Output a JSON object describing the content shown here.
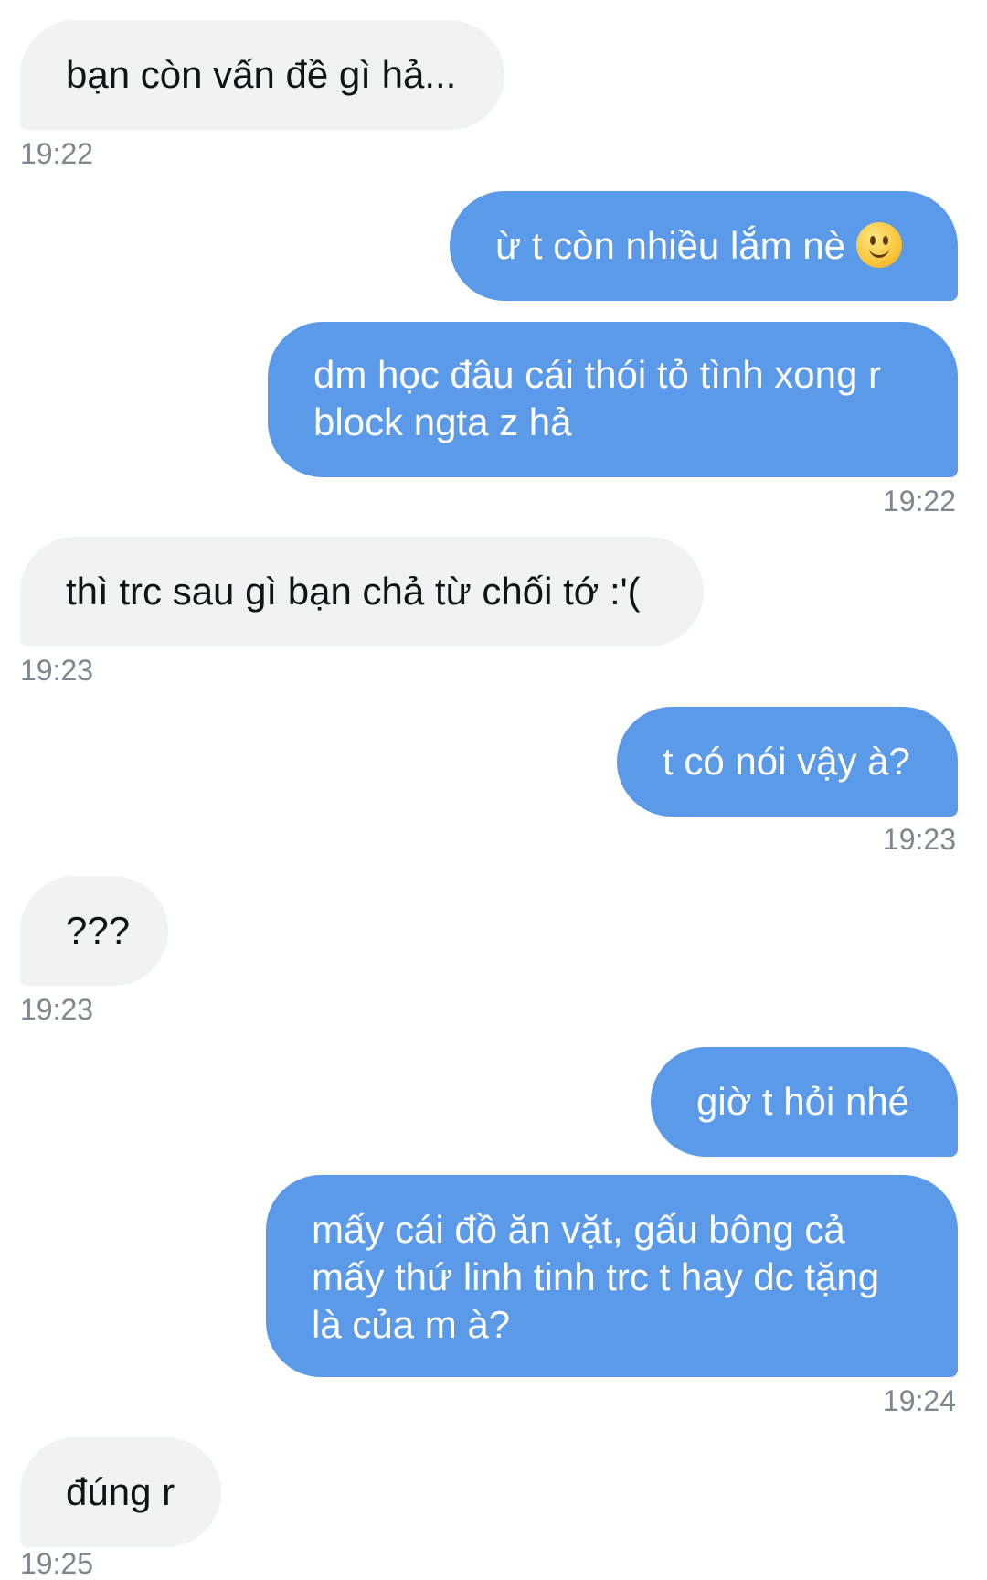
{
  "messages": [
    {
      "side": "in",
      "text": "bạn còn vấn đề gì hả...",
      "time": "19:22"
    },
    {
      "side": "out",
      "text": "ừ t còn nhiều lắm nè",
      "emoji": "slightly-smiling-face-icon"
    },
    {
      "side": "out",
      "text": "dm học đâu cái thói tỏ tình xong r block ngta z hả",
      "time": "19:22"
    },
    {
      "side": "in",
      "text": "thì trc sau gì bạn chả từ chối tớ :'(",
      "time": "19:23"
    },
    {
      "side": "out",
      "text": "t có nói vậy à?",
      "time": "19:23"
    },
    {
      "side": "in",
      "text": "???",
      "time": "19:23"
    },
    {
      "side": "out",
      "text": "giờ t hỏi nhé"
    },
    {
      "side": "out",
      "text": "mấy cái đồ ăn vặt, gấu bông cả mấy thứ linh tinh trc t hay dc tặng là của m à?",
      "time": "19:24"
    },
    {
      "side": "in",
      "text": "đúng r",
      "time": "19:25"
    }
  ],
  "colors": {
    "incoming_bubble": "#eff3f4",
    "outgoing_bubble": "#5b9ae8",
    "timestamp": "#7b8791"
  }
}
